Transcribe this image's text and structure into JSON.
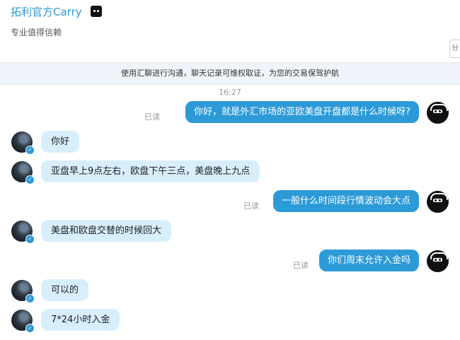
{
  "header": {
    "title": "拓利官方Carry",
    "subtitle": "专业值得信赖",
    "corner_button": "分"
  },
  "notice": "使用汇聊进行沟通，聊天记录可维权取证，为您的交易保驾护航",
  "timestamp": "16:27",
  "read_label": "已读",
  "messages": [
    {
      "side": "out",
      "text": "你好，就是外汇市场的亚欧美盘开盘都是什么时候呀?"
    },
    {
      "side": "in",
      "text": "你好"
    },
    {
      "side": "in",
      "text": "亚盘早上9点左右，欧盘下午三点，美盘晚上九点"
    },
    {
      "side": "out",
      "text": "一般什么时间段行情波动会大点"
    },
    {
      "side": "in",
      "text": "美盘和欧盘交替的时候回大"
    },
    {
      "side": "out",
      "text": "你们周末允许入金吗"
    },
    {
      "side": "in",
      "text": "可以的"
    },
    {
      "side": "in",
      "text": "7*24小时入金"
    }
  ],
  "colors": {
    "accent": "#2d9ad8",
    "incoming_bubble": "#d8eefb",
    "notice_bg": "#eef4f9"
  }
}
